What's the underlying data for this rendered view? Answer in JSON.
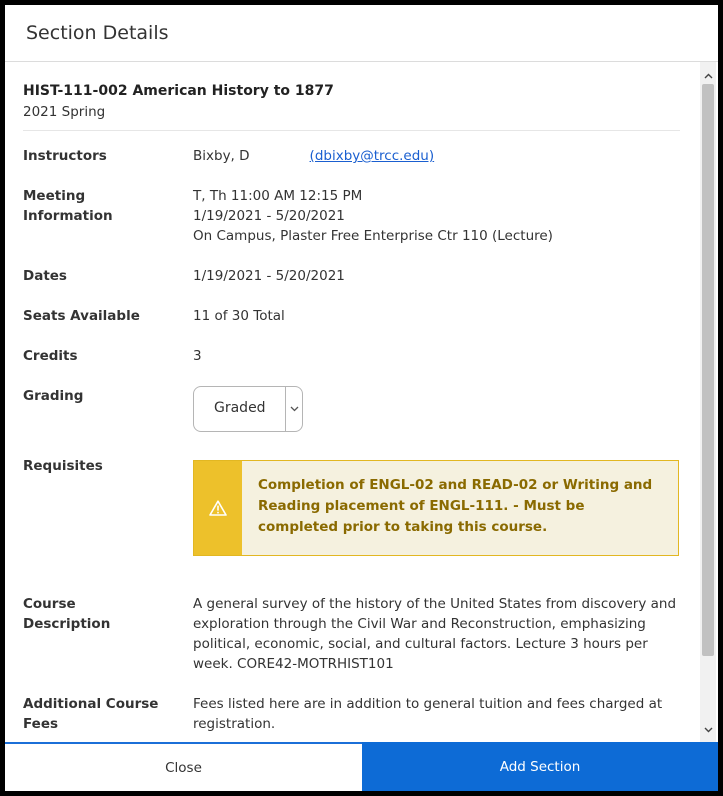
{
  "dialog": {
    "title": "Section Details"
  },
  "section": {
    "course_title": "HIST-111-002 American History to 1877",
    "term": "2021 Spring"
  },
  "rows": {
    "instructors": {
      "label": "Instructors",
      "name": "Bixby, D",
      "email": "(dbixby@trcc.edu)"
    },
    "meeting": {
      "label_line1": "Meeting",
      "label_line2": "Information",
      "line1": "T, Th 11:00 AM 12:15 PM",
      "line2": "1/19/2021 - 5/20/2021",
      "line3": "On Campus, Plaster Free Enterprise Ctr 110 (Lecture)"
    },
    "dates": {
      "label": "Dates",
      "value": "1/19/2021 - 5/20/2021"
    },
    "seats": {
      "label": "Seats Available",
      "value": "11 of 30 Total"
    },
    "credits": {
      "label": "Credits",
      "value": "3"
    },
    "grading": {
      "label": "Grading",
      "selected": "Graded"
    },
    "requisites": {
      "label": "Requisites",
      "text": "Completion of ENGL-02 and READ-02 or Writing and Reading placement of ENGL-111. - Must be completed prior to taking this course."
    },
    "description": {
      "label_line1": "Course",
      "label_line2": "Description",
      "text": "A general survey of the history of the United States from discovery and exploration through the Civil War and Reconstruction, emphasizing political, economic, social, and cultural factors. Lecture 3 hours per week. CORE42-MOTRHIST101"
    },
    "fees": {
      "label_line1": "Additional Course",
      "label_line2": "Fees",
      "text": "Fees listed here are in addition to general tuition and fees charged at registration."
    }
  },
  "footer": {
    "close_label": "Close",
    "add_label": "Add Section"
  },
  "colors": {
    "primary": "#0d6bd6",
    "link": "#1a5fd0",
    "warning_accent": "#edc12b",
    "warning_bg": "#f5f1df",
    "warning_text": "#8a6a00"
  },
  "icons": {
    "warning": "warning-icon",
    "scroll_up": "chevron-up-icon",
    "scroll_down": "chevron-down-icon",
    "select": "chevron-down-icon"
  }
}
